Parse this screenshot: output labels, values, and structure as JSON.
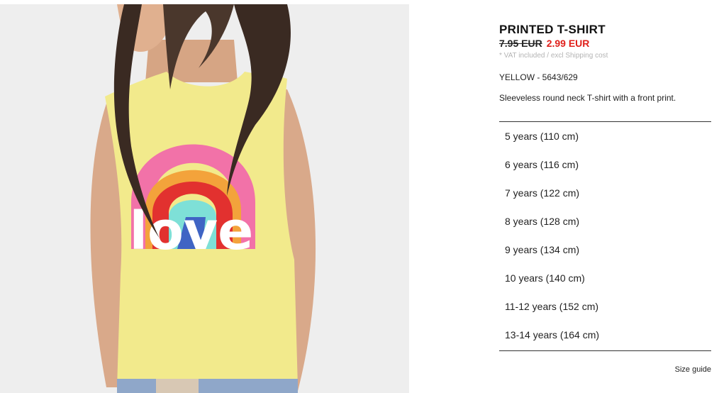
{
  "product": {
    "title": "PRINTED T-SHIRT",
    "old_price": "7.95 EUR",
    "new_price": "2.99 EUR",
    "vat_note": "* VAT included / excl Shipping cost",
    "color_ref": "YELLOW - 5643/629",
    "description": "Sleeveless round neck T-shirt with a front print.",
    "print_text": "love"
  },
  "sizes": [
    "5 years (110 cm)",
    "6 years (116 cm)",
    "7 years (122 cm)",
    "8 years (128 cm)",
    "9 years (134 cm)",
    "10 years (140 cm)",
    "11-12 years (152 cm)",
    "13-14 years (164 cm)"
  ],
  "size_guide_label": "Size guide",
  "colors": {
    "sale_red": "#e0201b",
    "shirt_yellow": "#f2ea8c"
  }
}
